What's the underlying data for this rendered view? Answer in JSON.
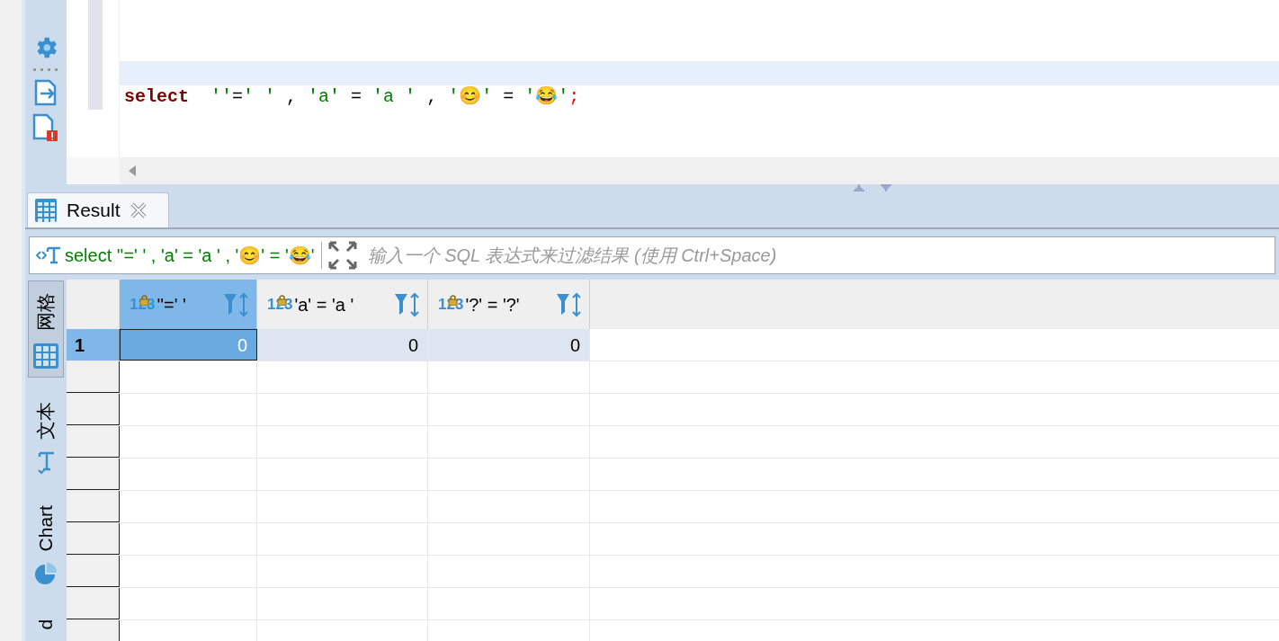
{
  "editor": {
    "code_tokens": [
      {
        "kind": "keyword",
        "text": "select"
      },
      {
        "kind": "string",
        "text": "  ''"
      },
      {
        "kind": "plain",
        "text": "="
      },
      {
        "kind": "string",
        "text": "' '"
      },
      {
        "kind": "plain",
        "text": " , "
      },
      {
        "kind": "string",
        "text": "'a'"
      },
      {
        "kind": "plain",
        "text": " = "
      },
      {
        "kind": "string",
        "text": "'a '"
      },
      {
        "kind": "plain",
        "text": " , "
      },
      {
        "kind": "string",
        "text": "'😊'"
      },
      {
        "kind": "plain",
        "text": " = "
      },
      {
        "kind": "string",
        "text": "'😂'"
      },
      {
        "kind": "terminator",
        "text": ";"
      }
    ]
  },
  "result_tab": {
    "label": "Result",
    "selected": true
  },
  "filter": {
    "query": "select ''=' ' , 'a' = 'a ' , '😊' = '😂'",
    "placeholder": "输入一个 SQL 表达式来过滤结果 (使用 Ctrl+Space)"
  },
  "view_tabs": [
    {
      "kind": "grid",
      "label": "网格",
      "selected": true
    },
    {
      "kind": "text",
      "label": "文本",
      "selected": false
    },
    {
      "kind": "chart",
      "label": "Chart",
      "selected": false
    },
    {
      "kind": "plain",
      "label": "d",
      "selected": false
    }
  ],
  "table": {
    "columns": [
      {
        "type_label": "123",
        "label": "''=' '",
        "selected": true
      },
      {
        "type_label": "123",
        "label": "'a' = 'a '",
        "selected": false
      },
      {
        "type_label": "123",
        "label": "'?' = '?'",
        "selected": false
      }
    ],
    "rows": [
      {
        "number": "1",
        "selected": true,
        "cells": [
          {
            "value": "0",
            "focused": true
          },
          {
            "value": "0",
            "focused": false
          },
          {
            "value": "0",
            "focused": false
          }
        ]
      }
    ]
  }
}
